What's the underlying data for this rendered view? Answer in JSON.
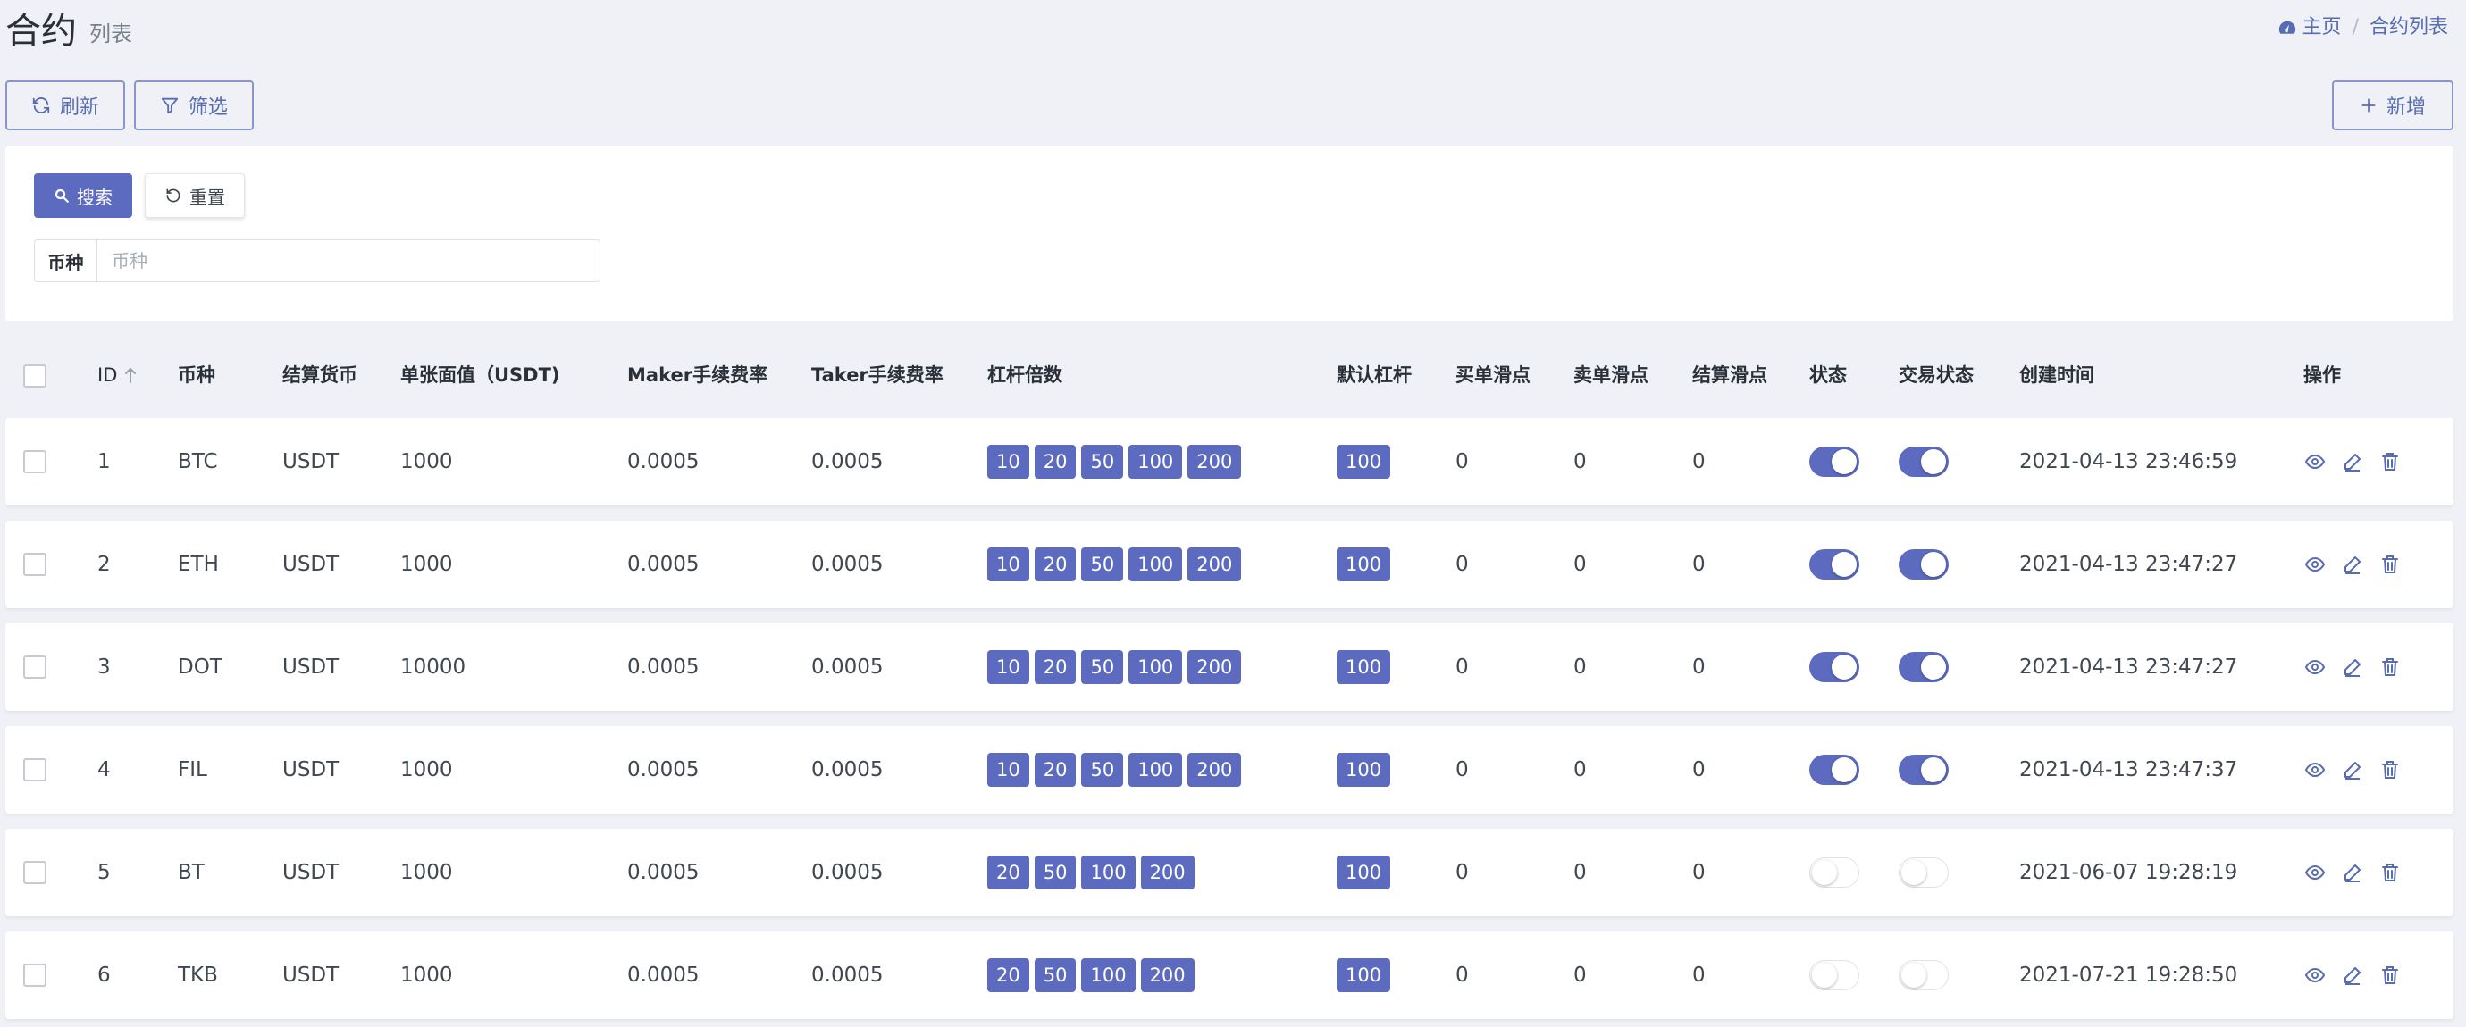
{
  "header": {
    "title": "合约",
    "subtitle": "列表"
  },
  "breadcrumb": {
    "home": "主页",
    "current": "合约列表"
  },
  "toolbar": {
    "refresh": "刷新",
    "filter": "筛选",
    "add": "新增"
  },
  "filter": {
    "search": "搜索",
    "reset": "重置",
    "field_label": "币种",
    "field_placeholder": "币种",
    "field_value": ""
  },
  "table": {
    "headers": {
      "id": "ID",
      "symbol": "币种",
      "settle": "结算货币",
      "face": "单张面值（USDT)",
      "maker": "Maker手续费率",
      "taker": "Taker手续费率",
      "leverage": "杠杆倍数",
      "default_leverage": "默认杠杆",
      "buy_slip": "买单滑点",
      "sell_slip": "卖单滑点",
      "settle_slip": "结算滑点",
      "status": "状态",
      "trade_status": "交易状态",
      "created": "创建时间",
      "ops": "操作"
    },
    "rows": [
      {
        "id": "1",
        "symbol": "BTC",
        "settle": "USDT",
        "face": "1000",
        "maker": "0.0005",
        "taker": "0.0005",
        "leverage": [
          "10",
          "20",
          "50",
          "100",
          "200"
        ],
        "default_leverage": "100",
        "buy_slip": "0",
        "sell_slip": "0",
        "settle_slip": "0",
        "status": true,
        "trade_status": true,
        "created": "2021-04-13 23:46:59"
      },
      {
        "id": "2",
        "symbol": "ETH",
        "settle": "USDT",
        "face": "1000",
        "maker": "0.0005",
        "taker": "0.0005",
        "leverage": [
          "10",
          "20",
          "50",
          "100",
          "200"
        ],
        "default_leverage": "100",
        "buy_slip": "0",
        "sell_slip": "0",
        "settle_slip": "0",
        "status": true,
        "trade_status": true,
        "created": "2021-04-13 23:47:27"
      },
      {
        "id": "3",
        "symbol": "DOT",
        "settle": "USDT",
        "face": "10000",
        "maker": "0.0005",
        "taker": "0.0005",
        "leverage": [
          "10",
          "20",
          "50",
          "100",
          "200"
        ],
        "default_leverage": "100",
        "buy_slip": "0",
        "sell_slip": "0",
        "settle_slip": "0",
        "status": true,
        "trade_status": true,
        "created": "2021-04-13 23:47:27"
      },
      {
        "id": "4",
        "symbol": "FIL",
        "settle": "USDT",
        "face": "1000",
        "maker": "0.0005",
        "taker": "0.0005",
        "leverage": [
          "10",
          "20",
          "50",
          "100",
          "200"
        ],
        "default_leverage": "100",
        "buy_slip": "0",
        "sell_slip": "0",
        "settle_slip": "0",
        "status": true,
        "trade_status": true,
        "created": "2021-04-13 23:47:37"
      },
      {
        "id": "5",
        "symbol": "BT",
        "settle": "USDT",
        "face": "1000",
        "maker": "0.0005",
        "taker": "0.0005",
        "leverage": [
          "20",
          "50",
          "100",
          "200"
        ],
        "default_leverage": "100",
        "buy_slip": "0",
        "sell_slip": "0",
        "settle_slip": "0",
        "status": false,
        "trade_status": false,
        "created": "2021-06-07 19:28:19"
      },
      {
        "id": "6",
        "symbol": "TKB",
        "settle": "USDT",
        "face": "1000",
        "maker": "0.0005",
        "taker": "0.0005",
        "leverage": [
          "20",
          "50",
          "100",
          "200"
        ],
        "default_leverage": "100",
        "buy_slip": "0",
        "sell_slip": "0",
        "settle_slip": "0",
        "status": false,
        "trade_status": false,
        "created": "2021-07-21 19:28:50"
      }
    ]
  },
  "icons": {
    "home": "dashboard-icon",
    "refresh": "refresh-icon",
    "filter": "filter-icon",
    "add": "plus-icon",
    "search": "search-icon",
    "reset": "undo-icon",
    "sort": "sort-up-icon",
    "view": "eye-icon",
    "edit": "edit-icon",
    "delete": "trash-icon"
  },
  "colors": {
    "accent": "#5c6bc0",
    "background": "#eff1f7",
    "link": "#586cb1"
  }
}
